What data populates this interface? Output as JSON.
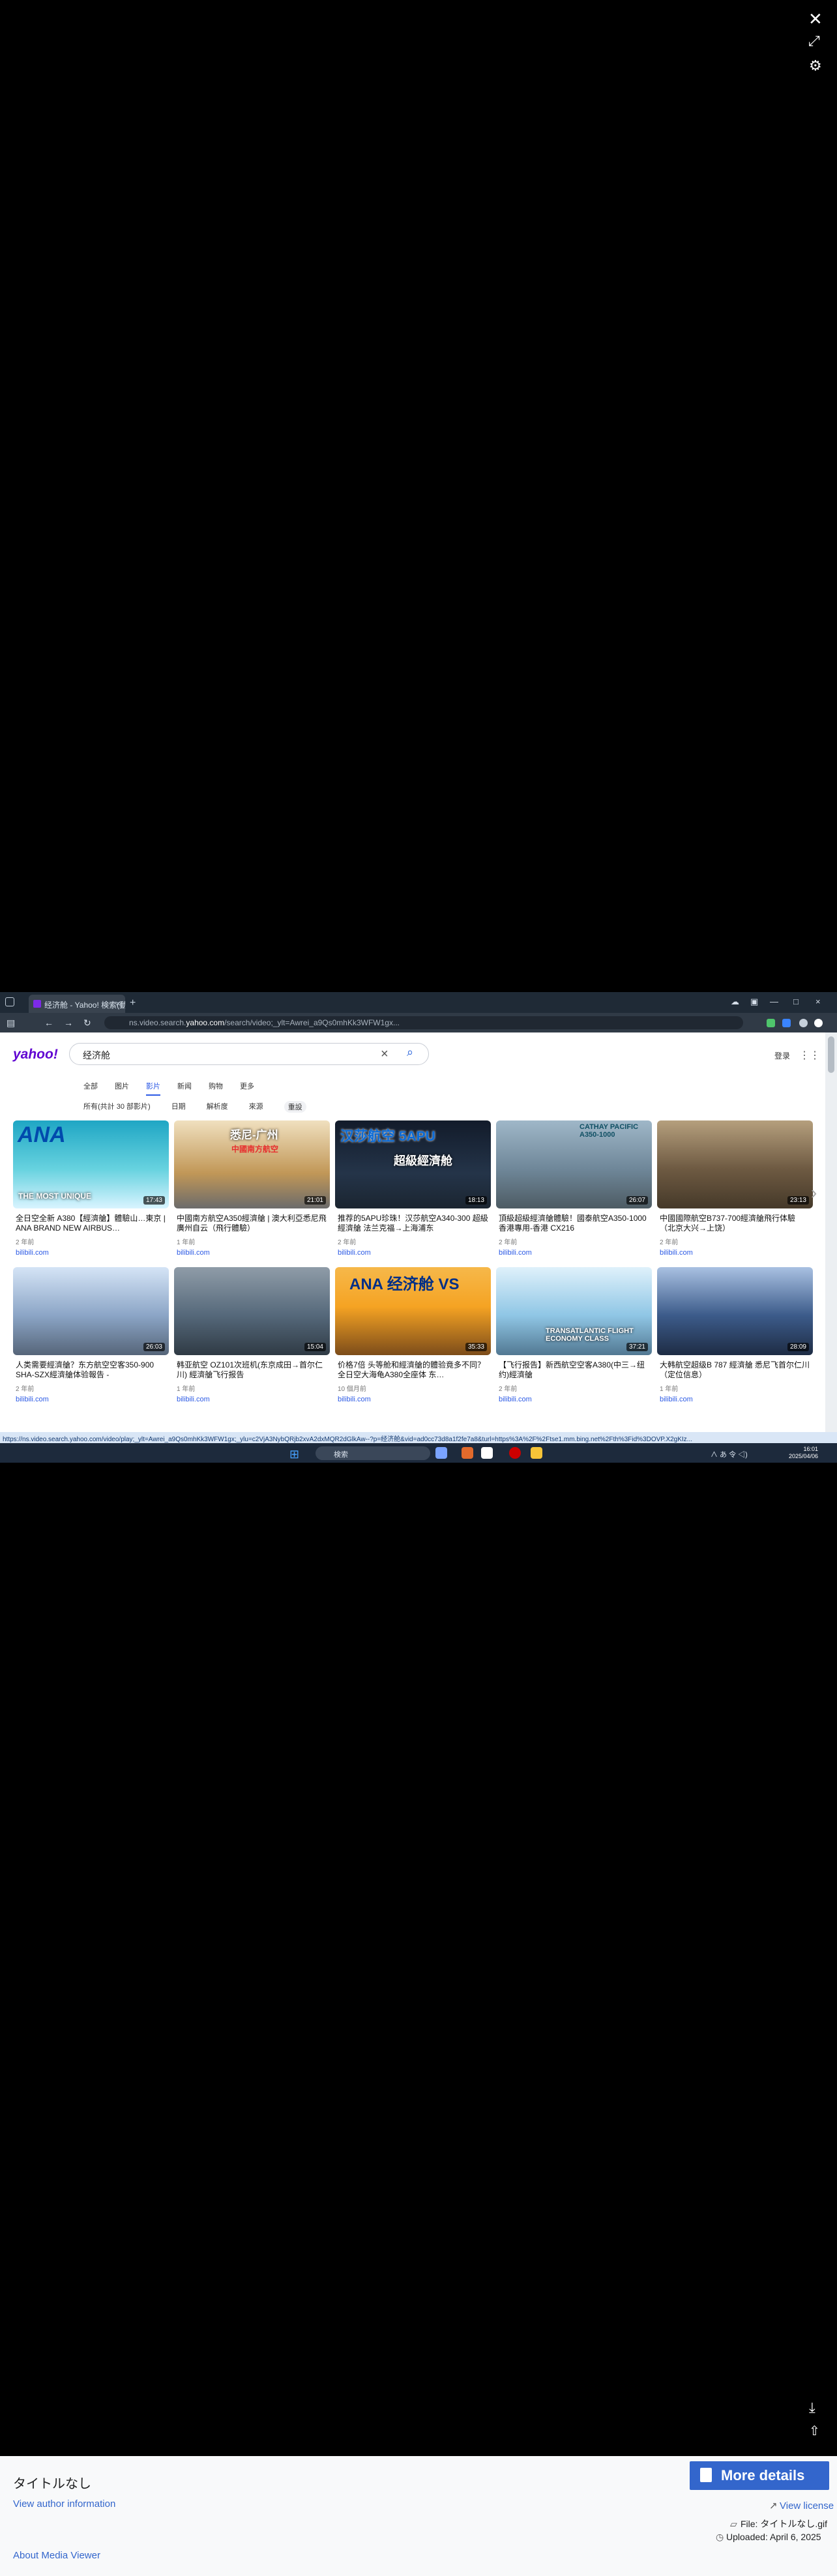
{
  "viewer": {
    "close_icon": "close-icon",
    "expand_icon": "expand-icon",
    "settings_icon": "gear-icon",
    "download_icon": "download-icon",
    "share_icon": "share-icon"
  },
  "browser": {
    "tab_title": "经济舱 - Yahoo! 検索(動画)",
    "tab_close": "×",
    "newtab": "+",
    "url_prefix": "ns.video.search.",
    "url_domain": "yahoo.com",
    "url_suffix": "/search/video;_ylt=Awrei_a9Qs0mhKk3WFW1gx...",
    "status_url": "https://ns.video.search.yahoo.com/video/play;_ylt=Awrei_a9Qs0mhKk3WFW1gx;_ylu=c2VjA3NybQRjb2xvA2dxMQR2dGlkAw--?p=经济舱&vid=ad0cc73d8a1f2fe7a8&turl=https%3A%2F%2Ftse1.mm.bing.net%2Fth%3Fid%3DOVP.X2gKIz..."
  },
  "yahoo": {
    "logo": "yahoo!",
    "query": "经济舱",
    "login": "登录",
    "tabs": [
      "全部",
      "图片",
      "影片",
      "新闻",
      "购物",
      "更多"
    ],
    "filters": [
      "所有(共計 30 部影片)",
      "日期",
      "解析度",
      "來源",
      "重設"
    ]
  },
  "videos": [
    {
      "title": "全日空全新 A380【經濟艙】體驗山…東京 | ANA BRAND NEW AIRBUS…",
      "views": "2 年前",
      "source": "bilibili.com",
      "duration": "17:43",
      "thumb_text": "ANA",
      "thumb_caption": "THE MOST UNIQUE",
      "thumb_color": "#1fa6c4"
    },
    {
      "title": "中國南方航空A350經濟艙 | 澳大利亞悉尼飛廣州自云（飛行體驗）",
      "views": "1 年前",
      "source": "bilibili.com",
      "duration": "21:01",
      "thumb_text": "悉尼-广州",
      "thumb_caption": "中國南方航空",
      "thumb_color": "#c19757"
    },
    {
      "title": "推荐的5APU珍珠！汉莎航空A340-300 超級經濟艙 法兰克福→上海浦东",
      "views": "2 年前",
      "source": "bilibili.com",
      "duration": "18:13",
      "thumb_text": "汉莎航空 5APU",
      "thumb_caption": "超級經濟舱",
      "thumb_color": "#243449"
    },
    {
      "title": "頂級超級經濟艙體驗！國泰航空A350-1000 香港專用-香港 CX216",
      "views": "2 年前",
      "source": "bilibili.com",
      "duration": "26:07",
      "thumb_text": "CATHAY PACIFIC A350-1000",
      "thumb_caption": "",
      "thumb_color": "#6f8799"
    },
    {
      "title": "中國國際航空B737-700經濟艙飛行体驗（北京大兴→上饶）",
      "views": "2 年前",
      "source": "bilibili.com",
      "duration": "23:13",
      "thumb_text": "",
      "thumb_caption": "",
      "thumb_color": "#6e5a42"
    },
    {
      "title": "人类需要經濟艙？东方航空空客350-900 SHA-SZX經濟艙体验報告 -",
      "views": "2 年前",
      "source": "bilibili.com",
      "duration": "26:03",
      "thumb_text": "",
      "thumb_caption": "",
      "thumb_color": "#8ba5c6"
    },
    {
      "title": "韩亚航空 OZ101次班机(东京成田→首尔仁川) 經濟艙飞行报告",
      "views": "1 年前",
      "source": "bilibili.com",
      "duration": "15:04",
      "thumb_text": "",
      "thumb_caption": "",
      "thumb_color": "#55687a"
    },
    {
      "title": "价格7倍 头等舱和經濟艙的體验竟多不同？全日空大海龟A380全座体 东…",
      "views": "10 個月前",
      "source": "bilibili.com",
      "duration": "35:33",
      "thumb_text": "ANA 经济舱 VS",
      "thumb_caption": "",
      "thumb_color": "#f5a323"
    },
    {
      "title": "【飞行报告】新西航空空客A380(中三→纽约)經濟艙",
      "views": "2 年前",
      "source": "bilibili.com",
      "duration": "37:21",
      "thumb_text": "TRANSATLANTIC FLIGHT ECONOMY CLASS",
      "thumb_caption": "",
      "thumb_color": "#8fc6e5"
    },
    {
      "title": "大韩航空超级B 787 經濟艙 悉尼飞首尔仁川（定位信息）",
      "views": "1 年前",
      "source": "bilibili.com",
      "duration": "28:09",
      "thumb_text": "",
      "thumb_caption": "",
      "thumb_color": "#3c5b8a"
    }
  ],
  "taskbar": {
    "search": "検索",
    "time": "16:01",
    "date": "2025/04/06",
    "tray": "∧  あ  令  ◁)"
  },
  "footer": {
    "title": "タイトルなし",
    "more_details": "More details",
    "author_info": "View author information",
    "license": "View license",
    "file": "File: タイトルなし.gif",
    "uploaded": "Uploaded: April 6, 2025",
    "media_viewer": "About Media Viewer"
  }
}
